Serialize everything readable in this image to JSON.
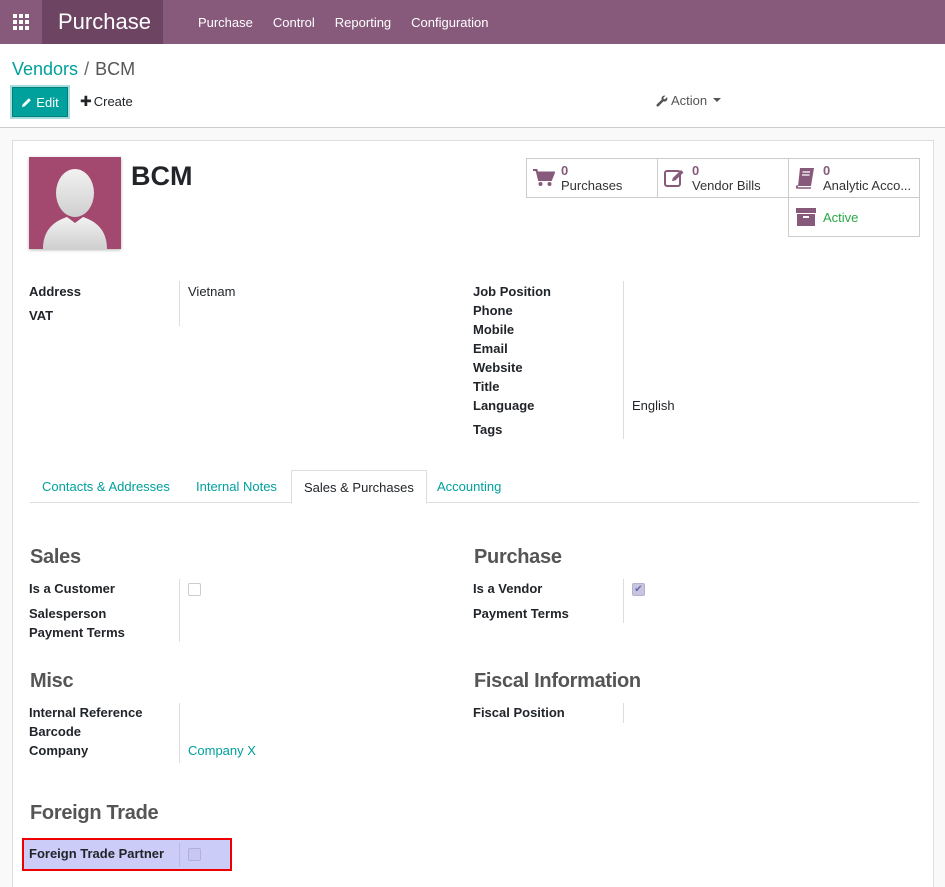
{
  "app": {
    "name": "Purchase",
    "menu": [
      "Purchase",
      "Control",
      "Reporting",
      "Configuration"
    ]
  },
  "breadcrumb": {
    "parent": "Vendors",
    "separator": "/",
    "current": "BCM"
  },
  "toolbar": {
    "edit_label": "Edit",
    "create_label": "Create",
    "action_label": "Action"
  },
  "record": {
    "name": "BCM"
  },
  "smart_buttons": {
    "purchases": {
      "value": "0",
      "label": "Purchases"
    },
    "vendor_bills": {
      "value": "0",
      "label": "Vendor Bills"
    },
    "analytic": {
      "value": "0",
      "label": "Analytic Acco..."
    },
    "active": {
      "label": "Active"
    }
  },
  "main_fields": {
    "address_label": "Address",
    "address_value": "Vietnam",
    "vat_label": "VAT",
    "job_position_label": "Job Position",
    "phone_label": "Phone",
    "mobile_label": "Mobile",
    "email_label": "Email",
    "website_label": "Website",
    "title_label": "Title",
    "language_label": "Language",
    "language_value": "English",
    "tags_label": "Tags"
  },
  "tabs": [
    "Contacts & Addresses",
    "Internal Notes",
    "Sales & Purchases",
    "Accounting"
  ],
  "sales": {
    "title": "Sales",
    "is_customer_label": "Is a Customer",
    "salesperson_label": "Salesperson",
    "payment_terms_label": "Payment Terms"
  },
  "purchase": {
    "title": "Purchase",
    "is_vendor_label": "Is a Vendor",
    "payment_terms_label": "Payment Terms"
  },
  "misc": {
    "title": "Misc",
    "internal_reference_label": "Internal Reference",
    "barcode_label": "Barcode",
    "company_label": "Company",
    "company_value": "Company X"
  },
  "fiscal": {
    "title": "Fiscal Information",
    "fiscal_position_label": "Fiscal Position"
  },
  "foreign_trade": {
    "title": "Foreign Trade",
    "partner_label": "Foreign Trade Partner"
  },
  "colors": {
    "brand": "#875a7b",
    "accent": "#00a09d",
    "highlight": "#e00000"
  }
}
